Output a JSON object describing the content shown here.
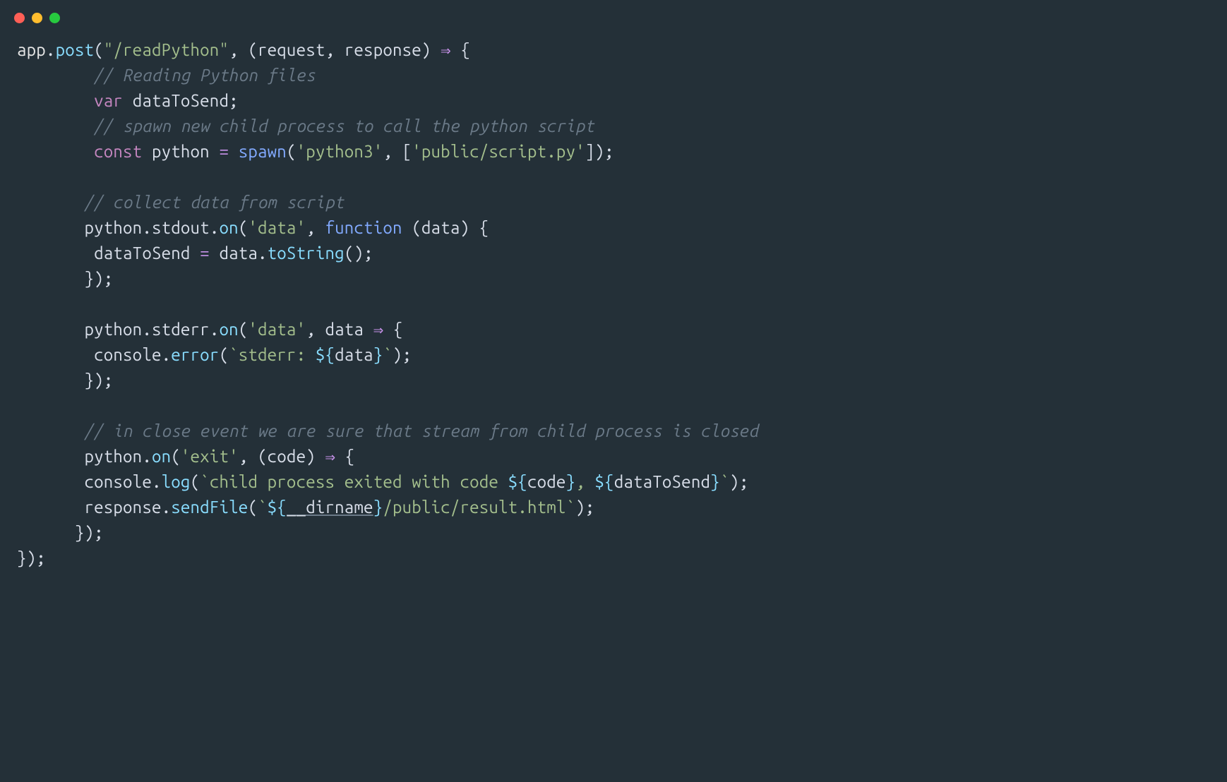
{
  "window": {
    "dots": [
      "red",
      "yellow",
      "green"
    ]
  },
  "colors": {
    "background": "#243038",
    "red": "#ff5f56",
    "yellow": "#ffbd2e",
    "green": "#27c93f",
    "string": "#a3be8c",
    "keyword": "#c586c0",
    "func": "#82aaff",
    "method": "#89ddff",
    "comment": "#6b7a88"
  },
  "code": {
    "l1_app": "app",
    "l1_dot1": ".",
    "l1_post": "post",
    "l1_open1": "(",
    "l1_str": "\"/readPython\"",
    "l1_comma": ", ",
    "l1_open2": "(",
    "l1_req": "request",
    "l1_comma2": ", ",
    "l1_res": "response",
    "l1_close1": ")",
    "l1_arrow": " ⇒ ",
    "l1_brace": "{",
    "l2_indent": "        ",
    "l2_comment": "// Reading Python files",
    "l3_indent": "        ",
    "l3_var": "var",
    "l3_space": " ",
    "l3_ident": "dataToSend",
    "l3_semi": ";",
    "l4_indent": "        ",
    "l4_comment": "// spawn new child process to call the python script",
    "l5_indent": "        ",
    "l5_const": "const",
    "l5_sp1": " ",
    "l5_python": "python",
    "l5_sp2": " ",
    "l5_eq": "=",
    "l5_sp3": " ",
    "l5_spawn": "spawn",
    "l5_open": "(",
    "l5_str1": "'python3'",
    "l5_comma": ", ",
    "l5_brk": "[",
    "l5_str2": "'public/script.py'",
    "l5_brk2": "]",
    "l5_close": ")",
    "l5_semi": ";",
    "l7_indent": "       ",
    "l7_comment": "// collect data from script",
    "l8_indent": "       ",
    "l8_python": "python",
    "l8_dot1": ".",
    "l8_stdout": "stdout",
    "l8_dot2": ".",
    "l8_on": "on",
    "l8_open": "(",
    "l8_str": "'data'",
    "l8_comma": ", ",
    "l8_function": "function",
    "l8_sp": " ",
    "l8_open2": "(",
    "l8_data": "data",
    "l8_close2": ")",
    "l8_sp2": " ",
    "l8_brace": "{",
    "l9_indent": "        ",
    "l9_dts": "dataToSend",
    "l9_sp": " ",
    "l9_eq": "=",
    "l9_sp2": " ",
    "l9_data": "data",
    "l9_dot": ".",
    "l9_toString": "toString",
    "l9_parens": "()",
    "l9_semi": ";",
    "l10_indent": "       ",
    "l10_close": "});",
    "l12_indent": "       ",
    "l12_python": "python",
    "l12_dot1": ".",
    "l12_stderr": "stderr",
    "l12_dot2": ".",
    "l12_on": "on",
    "l12_open": "(",
    "l12_str": "'data'",
    "l12_comma": ", ",
    "l12_data": "data",
    "l12_arrow": " ⇒ ",
    "l12_brace": "{",
    "l13_indent": "        ",
    "l13_console": "console",
    "l13_dot": ".",
    "l13_error": "error",
    "l13_open": "(",
    "l13_bt1": "`",
    "l13_lit": "stderr: ",
    "l13_tpl_open": "${",
    "l13_data": "data",
    "l13_tpl_close": "}",
    "l13_bt2": "`",
    "l13_close": ")",
    "l13_semi": ";",
    "l14_indent": "       ",
    "l14_close": "});",
    "l16_indent": "       ",
    "l16_comment": "// in close event we are sure that stream from child process is closed",
    "l17_indent": "       ",
    "l17_python": "python",
    "l17_dot": ".",
    "l17_on": "on",
    "l17_open": "(",
    "l17_str": "'exit'",
    "l17_comma": ", ",
    "l17_open2": "(",
    "l17_code": "code",
    "l17_close2": ")",
    "l17_arrow": " ⇒ ",
    "l17_brace": "{",
    "l18_indent": "       ",
    "l18_console": "console",
    "l18_dot": ".",
    "l18_log": "log",
    "l18_open": "(",
    "l18_bt1": "`",
    "l18_lit1": "child process exited with code ",
    "l18_tpl1o": "${",
    "l18_code": "code",
    "l18_tpl1c": "}",
    "l18_lit2": ", ",
    "l18_tpl2o": "${",
    "l18_dts": "dataToSend",
    "l18_tpl2c": "}",
    "l18_bt2": "`",
    "l18_close": ")",
    "l18_semi": ";",
    "l19_indent": "       ",
    "l19_response": "response",
    "l19_dot": ".",
    "l19_sendFile": "sendFile",
    "l19_open": "(",
    "l19_bt1": "`",
    "l19_tpl_o": "${",
    "l19_dirname": "__dirname",
    "l19_tpl_c": "}",
    "l19_lit": "/public/result.html",
    "l19_bt2": "`",
    "l19_close": ")",
    "l19_semi": ";",
    "l20_indent": "      ",
    "l20_close": "});",
    "l21_close": "});"
  }
}
